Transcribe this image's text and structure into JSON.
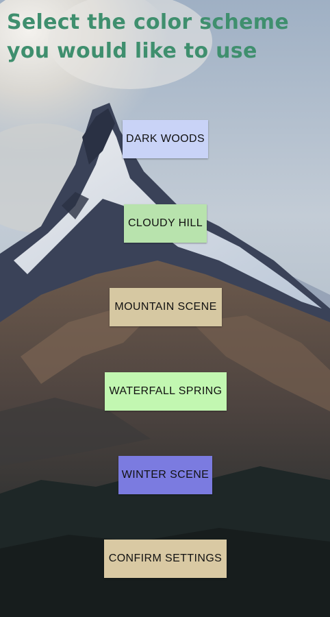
{
  "header": {
    "title": "Select the color scheme you would like to use"
  },
  "background": {
    "description_icon": "mountain-landscape-image"
  },
  "buttons": [
    {
      "id": "btn-dark-woods",
      "label": "DARK WOODS",
      "color": "#c9d3f7"
    },
    {
      "id": "btn-cloudy-hill",
      "label": "CLOUDY HILL",
      "color": "#b8e3ad"
    },
    {
      "id": "btn-mountain-scene",
      "label": "MOUNTAIN SCENE",
      "color": "#d6c8a2"
    },
    {
      "id": "btn-waterfall-spring",
      "label": "WATERFALL SPRING",
      "color": "#c2f7b1"
    },
    {
      "id": "btn-winter-scene",
      "label": "WINTER SCENE",
      "color": "#7b7be0"
    },
    {
      "id": "btn-confirm-settings",
      "label": "CONFIRM SETTINGS",
      "color": "#d9c9a3"
    }
  ],
  "colors": {
    "title": "#3f8f6e"
  }
}
